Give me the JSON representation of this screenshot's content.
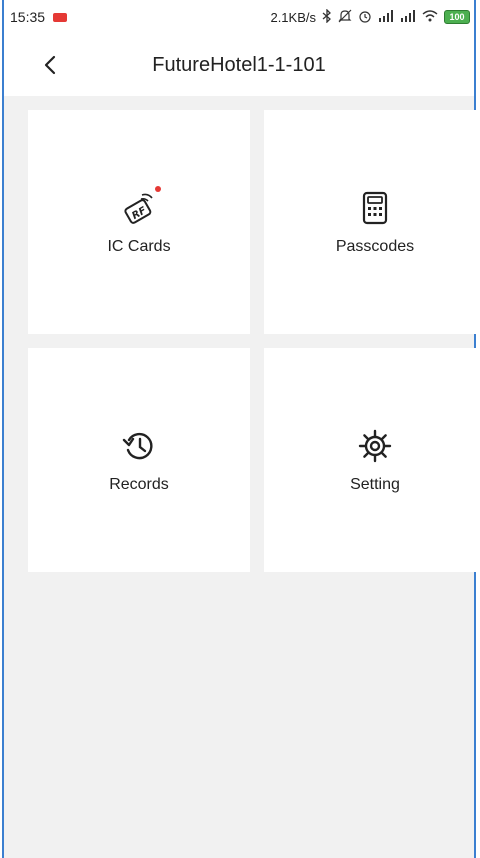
{
  "status_bar": {
    "time": "15:35",
    "net_speed": "2.1KB/s",
    "battery": "100"
  },
  "header": {
    "title": "FutureHotel1-1-101"
  },
  "tiles": [
    {
      "label": "IC Cards",
      "icon": "rf-card-icon",
      "has_notification": true
    },
    {
      "label": "Passcodes",
      "icon": "keypad-icon"
    },
    {
      "label": "Records",
      "icon": "history-icon"
    },
    {
      "label": "Setting",
      "icon": "gear-icon"
    }
  ]
}
